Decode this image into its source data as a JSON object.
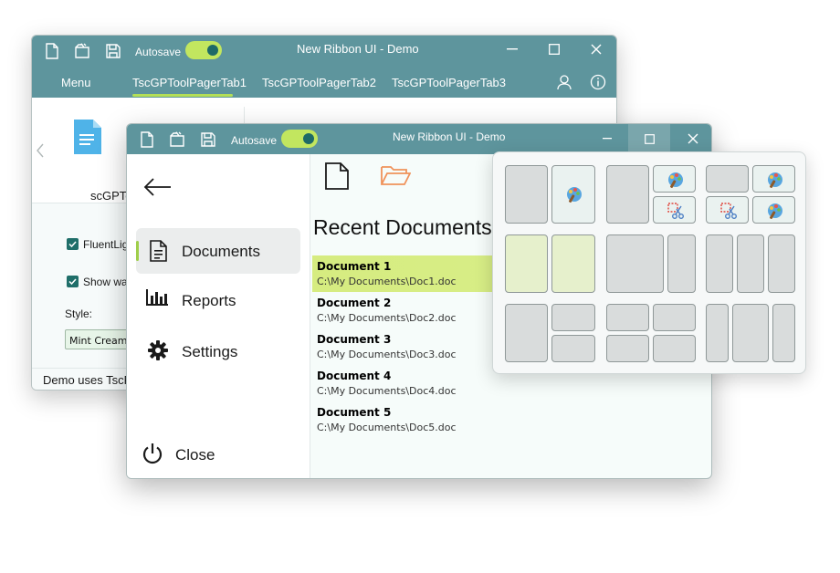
{
  "back_window": {
    "title": "New Ribbon UI - Demo",
    "autosave_label": "Autosave",
    "autosave_on": true,
    "tabs": [
      "Menu",
      "TscGPToolPagerTab1",
      "TscGPToolPagerTab2",
      "TscGPToolPagerTab3"
    ],
    "ribbon_item_label": "scGPTo",
    "check1_label": "FluentLigh",
    "check2_label": "Show wallp",
    "style_label": "Style:",
    "style_value": "Mint Cream",
    "status_text": "Demo uses TscF"
  },
  "front_window": {
    "title": "New Ribbon UI - Demo",
    "autosave_label": "Autosave",
    "autosave_on": true,
    "menu": [
      {
        "label": "Documents",
        "icon": "document-icon",
        "selected": true
      },
      {
        "label": "Reports",
        "icon": "chart-icon",
        "selected": false
      },
      {
        "label": "Settings",
        "icon": "gear-icon",
        "selected": false
      }
    ],
    "close_label": "Close",
    "heading": "Recent Documents",
    "documents": [
      {
        "title": "Document 1",
        "path": "C:\\My Documents\\Doc1.doc"
      },
      {
        "title": "Document 2",
        "path": "C:\\My Documents\\Doc2.doc"
      },
      {
        "title": "Document 3",
        "path": "C:\\My Documents\\Doc3.doc"
      },
      {
        "title": "Document 4",
        "path": "C:\\My Documents\\Doc4.doc"
      },
      {
        "title": "Document 5",
        "path": "C:\\My Documents\\Doc5.doc"
      }
    ]
  },
  "colors": {
    "titlebar": "#5e959d",
    "accent_green": "#c2e65f",
    "toggle_knob": "#1e6a67",
    "selected_row": "#d6ec80",
    "selection_bar": "#9fce4a"
  }
}
